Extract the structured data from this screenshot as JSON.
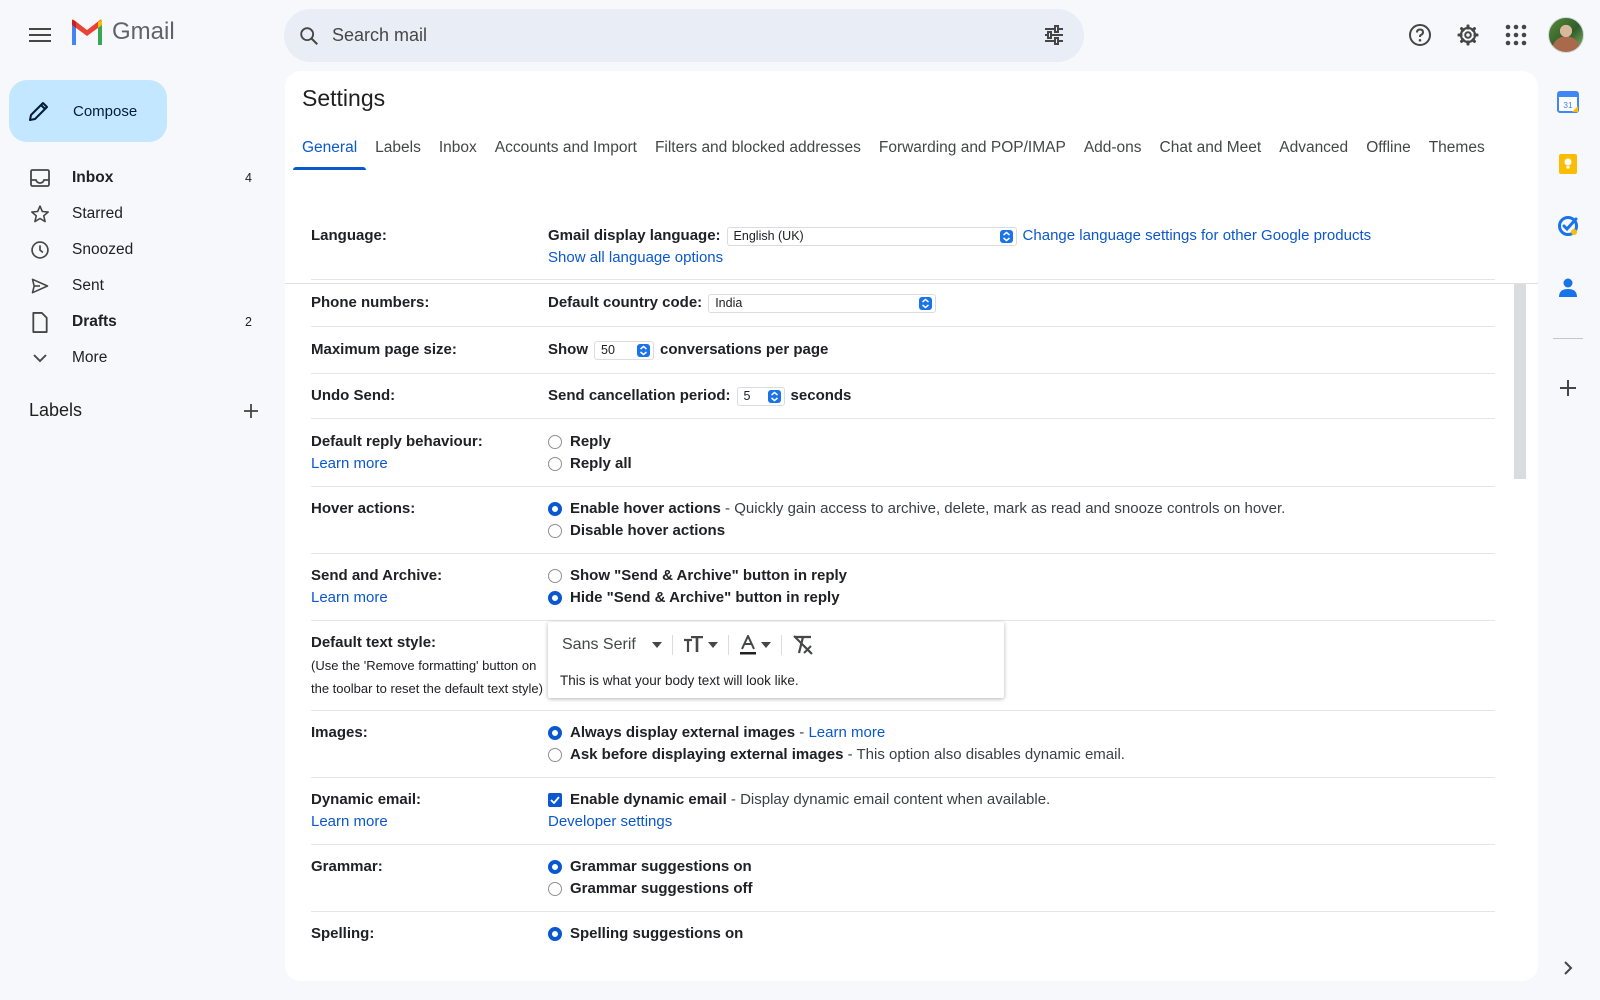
{
  "app": {
    "name": "Gmail"
  },
  "search": {
    "placeholder": "Search mail"
  },
  "compose": {
    "label": "Compose"
  },
  "nav": {
    "inbox": {
      "label": "Inbox",
      "count": "4"
    },
    "starred": {
      "label": "Starred"
    },
    "snoozed": {
      "label": "Snoozed"
    },
    "sent": {
      "label": "Sent"
    },
    "drafts": {
      "label": "Drafts",
      "count": "2"
    },
    "more": {
      "label": "More"
    }
  },
  "labels": {
    "title": "Labels"
  },
  "settings": {
    "title": "Settings",
    "tabs": [
      "General",
      "Labels",
      "Inbox",
      "Accounts and Import",
      "Filters and blocked addresses",
      "Forwarding and POP/IMAP",
      "Add-ons",
      "Chat and Meet",
      "Advanced",
      "Offline",
      "Themes"
    ],
    "active_tab": "General"
  },
  "rows": {
    "language": {
      "label": "Language:",
      "display_label": "Gmail display language:",
      "display_value": "English (UK)",
      "change_link": "Change language settings for other Google products",
      "show_all_link": "Show all language options"
    },
    "phone": {
      "label": "Phone numbers:",
      "country_label": "Default country code:",
      "country_value": "India"
    },
    "page_size": {
      "label": "Maximum page size:",
      "show": "Show",
      "value": "50",
      "suffix": "conversations per page"
    },
    "undo": {
      "label": "Undo Send:",
      "period_label": "Send cancellation period:",
      "value": "5",
      "suffix": "seconds"
    },
    "reply": {
      "label": "Default reply behaviour:",
      "learn_more": "Learn more",
      "opt1": "Reply",
      "opt2": "Reply all"
    },
    "hover": {
      "label": "Hover actions:",
      "opt1": "Enable hover actions",
      "opt1_desc": " - Quickly gain access to archive, delete, mark as read and snooze controls on hover.",
      "opt2": "Disable hover actions"
    },
    "send_archive": {
      "label": "Send and Archive:",
      "learn_more": "Learn more",
      "opt1": "Show \"Send & Archive\" button in reply",
      "opt2": "Hide \"Send & Archive\" button in reply"
    },
    "text_style": {
      "label": "Default text style:",
      "note": "(Use the 'Remove formatting' button on the toolbar to reset the default text style)",
      "font": "Sans Serif",
      "sample": "This is what your body text will look like."
    },
    "images": {
      "label": "Images:",
      "opt1": "Always display external images",
      "opt1_sep": " - ",
      "opt1_link": "Learn more",
      "opt2": "Ask before displaying external images",
      "opt2_desc": " - This option also disables dynamic email."
    },
    "dynamic": {
      "label": "Dynamic email:",
      "learn_more": "Learn more",
      "opt1": "Enable dynamic email",
      "opt1_desc": " - Display dynamic email content when available.",
      "dev_link": "Developer settings"
    },
    "grammar": {
      "label": "Grammar:",
      "opt1": "Grammar suggestions on",
      "opt2": "Grammar suggestions off"
    },
    "spelling": {
      "label": "Spelling:",
      "opt1": "Spelling suggestions on"
    }
  },
  "side_apps": {
    "calendar_day": "31"
  },
  "colors": {
    "accent": "#0b57d0",
    "compose_bg": "#c2e7ff",
    "page_bg": "#f6f8fc"
  }
}
